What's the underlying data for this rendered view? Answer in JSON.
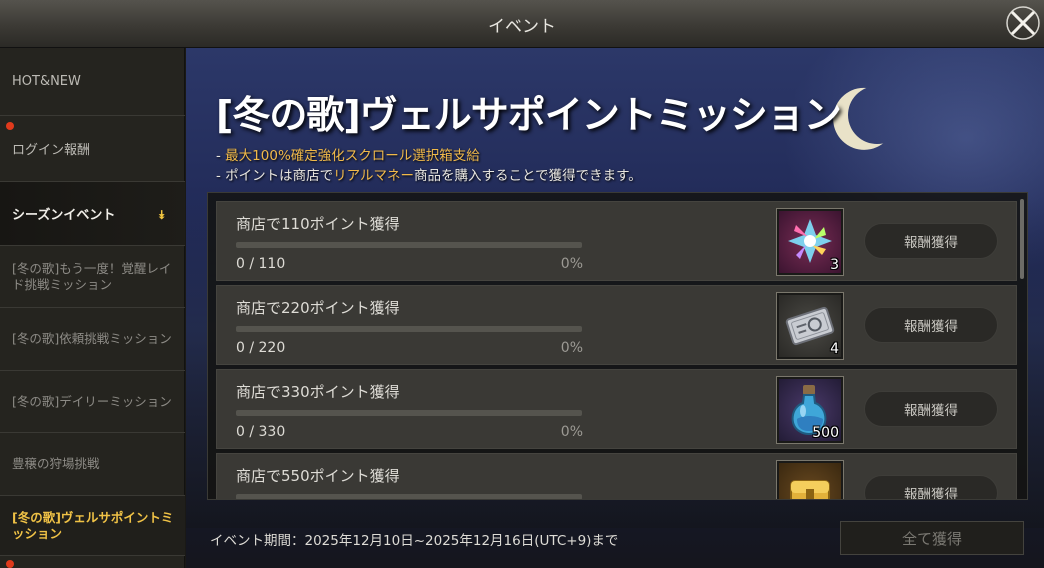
{
  "window": {
    "title": "イベント",
    "close_icon": "close-icon"
  },
  "sidebar": {
    "items": [
      {
        "label": "HOT&NEW"
      },
      {
        "label": "ログイン報酬",
        "badge": "red-dot"
      },
      {
        "label": "シーズンイベント",
        "icon": "expand-arrow-icon"
      },
      {
        "label": "[冬の歌]もう一度！覚醒レイド挑戦ミッション"
      },
      {
        "label": "[冬の歌]依頼挑戦ミッション"
      },
      {
        "label": "[冬の歌]デイリーミッション"
      },
      {
        "label": "豊穣の狩場挑戦"
      },
      {
        "label": "[冬の歌]ヴェルサポイントミッション"
      }
    ]
  },
  "main": {
    "title": "[冬の歌]ヴェルサポイントミッション",
    "desc1_prefix": "- ",
    "desc1_highlight": "最大100%確定強化スクロール選択箱支給",
    "desc2_prefix": "- ポイントは商店で",
    "desc2_highlight": "リアルマネー",
    "desc2_suffix": "商品を購入することで獲得できます。",
    "missions": [
      {
        "title": "商店で110ポイント獲得",
        "count": "0 / 110",
        "percent": "0%",
        "progress": 0,
        "reward_icon": "rainbow-crystal-icon",
        "reward_qty": "3",
        "button": "報酬獲得"
      },
      {
        "title": "商店で220ポイント獲得",
        "count": "0 / 220",
        "percent": "0%",
        "progress": 0,
        "reward_icon": "silver-ticket-icon",
        "reward_qty": "4",
        "button": "報酬獲得"
      },
      {
        "title": "商店で330ポイント獲得",
        "count": "0 / 330",
        "percent": "0%",
        "progress": 0,
        "reward_icon": "blue-potion-icon",
        "reward_qty": "500",
        "button": "報酬獲得"
      },
      {
        "title": "商店で550ポイント獲得",
        "count": "",
        "percent": "",
        "progress": 0,
        "reward_icon": "gold-chest-icon",
        "reward_qty": "",
        "button": "報酬獲得"
      }
    ],
    "period": "イベント期間：2025年12月10日~2025年12月16日(UTC+9)まで",
    "claim_all": "全て獲得"
  },
  "colors": {
    "accent": "#f0c246",
    "highlight": "#f0b94a",
    "badge": "#e03a1c"
  }
}
